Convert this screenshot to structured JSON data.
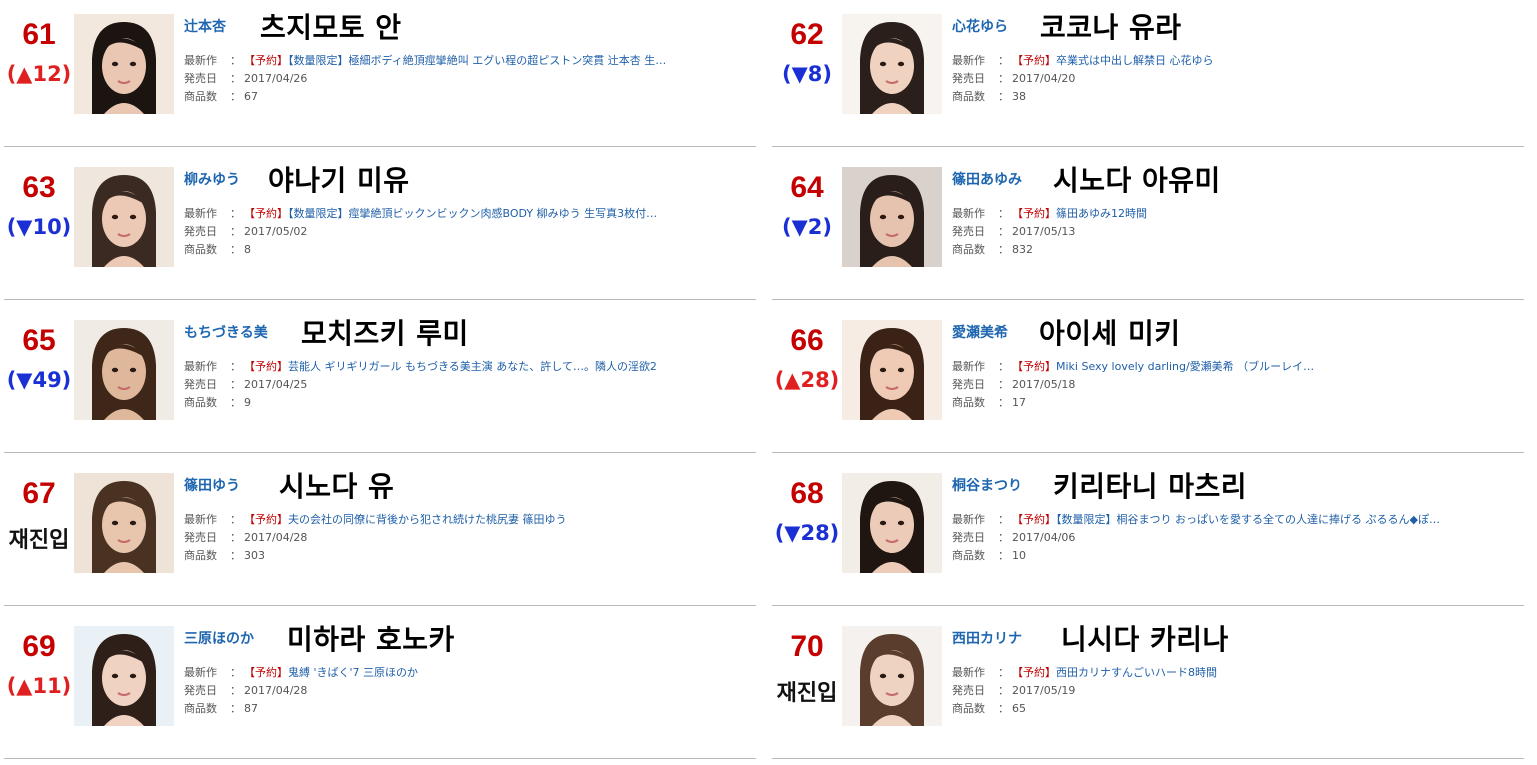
{
  "labels": {
    "newest": "最新作",
    "release": "発売日",
    "count": "商品数",
    "sep": "："
  },
  "entries": [
    {
      "rank": "61",
      "change": "(▲12)",
      "dir": "up",
      "jp": "辻本杏",
      "kr": "츠지모토 안",
      "tag": "【予約】",
      "title": "【数量限定】極細ボディ絶頂痙攣絶叫 エグい程の超ピストン突貫 辻本杏 生…",
      "date": "2017/04/26",
      "count": "67"
    },
    {
      "rank": "62",
      "change": "(▼8)",
      "dir": "down",
      "jp": "心花ゆら",
      "kr": "코코나 유라",
      "tag": "【予約】",
      "title": "卒業式は中出し解禁日 心花ゆら",
      "date": "2017/04/20",
      "count": "38"
    },
    {
      "rank": "63",
      "change": "(▼10)",
      "dir": "down",
      "jp": "柳みゆう",
      "kr": "야나기 미유",
      "tag": "【予約】",
      "title": "【数量限定】痙攣絶頂ビックンビックン肉感BODY 柳みゆう 生写真3枚付…",
      "date": "2017/05/02",
      "count": "8"
    },
    {
      "rank": "64",
      "change": "(▼2)",
      "dir": "down",
      "jp": "篠田あゆみ",
      "kr": "시노다 아유미",
      "tag": "【予約】",
      "title": "篠田あゆみ12時間",
      "date": "2017/05/13",
      "count": "832"
    },
    {
      "rank": "65",
      "change": "(▼49)",
      "dir": "down",
      "jp": "もちづきる美",
      "kr": "모치즈키 루미",
      "tag": "【予約】",
      "title": "芸能人 ギリギリガール もちづきる美主演 あなた、許して…。隣人の淫欲2",
      "date": "2017/04/25",
      "count": "9"
    },
    {
      "rank": "66",
      "change": "(▲28)",
      "dir": "up",
      "jp": "愛瀬美希",
      "kr": "아이세 미키",
      "tag": "【予約】",
      "title": "Miki Sexy lovely darling/愛瀬美希 （ブルーレイ…",
      "date": "2017/05/18",
      "count": "17"
    },
    {
      "rank": "67",
      "change": "재진입",
      "dir": "reentry",
      "jp": "篠田ゆう",
      "kr": "시노다 유",
      "tag": "【予約】",
      "title": "夫の会社の同僚に背後から犯され続けた桃尻妻 篠田ゆう",
      "date": "2017/04/28",
      "count": "303"
    },
    {
      "rank": "68",
      "change": "(▼28)",
      "dir": "down",
      "jp": "桐谷まつり",
      "kr": "키리타니 마츠리",
      "tag": "【予約】",
      "title": "【数量限定】桐谷まつり おっぱいを愛する全ての人達に捧げる ぷるるん◆ぽ…",
      "date": "2017/04/06",
      "count": "10"
    },
    {
      "rank": "69",
      "change": "(▲11)",
      "dir": "up",
      "jp": "三原ほのか",
      "kr": "미하라 호노카",
      "tag": "【予約】",
      "title": "鬼縛 'きばく'7 三原ほのか",
      "date": "2017/04/28",
      "count": "87"
    },
    {
      "rank": "70",
      "change": "재진입",
      "dir": "reentry",
      "jp": "西田カリナ",
      "kr": "니시다 카리나",
      "tag": "【予約】",
      "title": "西田カリナすんごいハード8時間",
      "date": "2017/05/19",
      "count": "65"
    }
  ],
  "colors": {
    "rank": "#c40000",
    "up": "#e02020",
    "down": "#1a2fd4",
    "jp_name": "#1f66b0",
    "tag": "#c00000",
    "title": "#1f5fa8"
  },
  "icons": {
    "photo": "portrait-photo-icon"
  }
}
